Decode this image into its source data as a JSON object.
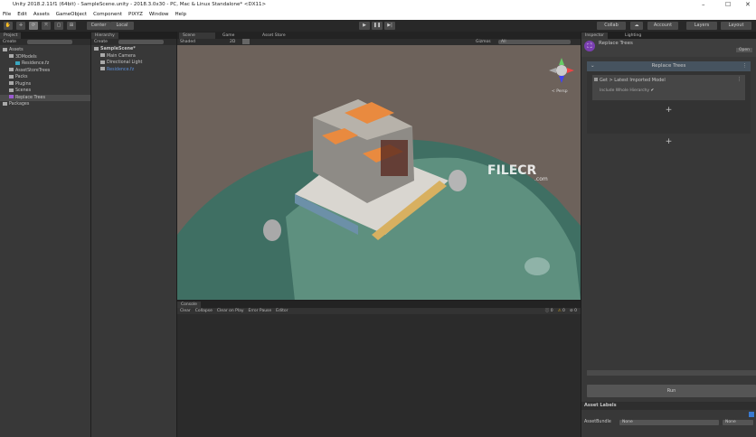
{
  "window": {
    "title": "Unity 2018.2.11f1 (64bit) - SampleScene.unity - 2018.3.0x30 - PC, Mac & Linux Standalone* <DX11>"
  },
  "menu": [
    "File",
    "Edit",
    "Assets",
    "GameObject",
    "Component",
    "PIXYZ",
    "Window",
    "Help"
  ],
  "toolbar": {
    "pivot": "Center",
    "space": "Local",
    "collab": "Collab",
    "account": "Account",
    "layers": "Layers",
    "layout": "Layout"
  },
  "project": {
    "tab": "Project",
    "create": "Create",
    "items": [
      {
        "label": "Assets",
        "depth": 0
      },
      {
        "label": "3DModels",
        "depth": 1
      },
      {
        "label": "Residence.fz",
        "depth": 2
      },
      {
        "label": "AssetStoreTrees",
        "depth": 1
      },
      {
        "label": "Packs",
        "depth": 1
      },
      {
        "label": "Plugins",
        "depth": 1
      },
      {
        "label": "Scenes",
        "depth": 1
      },
      {
        "label": "Replace Trees",
        "depth": 1
      },
      {
        "label": "Packages",
        "depth": 0
      }
    ]
  },
  "hierarchy": {
    "tab": "Hierarchy",
    "create": "Create",
    "items": [
      {
        "label": "SampleScene*",
        "depth": 0
      },
      {
        "label": "Main Camera",
        "depth": 1
      },
      {
        "label": "Directional Light",
        "depth": 1
      },
      {
        "label": "Residence.fz",
        "depth": 1
      }
    ]
  },
  "scene": {
    "tabs": [
      "Scene",
      "Game",
      "Asset Store"
    ],
    "shading": "Shaded",
    "mode2d": "2D",
    "gizmos": "Gizmos",
    "search": "All",
    "persp": "< Persp",
    "watermark": "FILECR",
    "watermark_sub": ".com"
  },
  "console": {
    "tab": "Console",
    "buttons": [
      "Clear",
      "Collapse",
      "Clear on Play",
      "Error Pause",
      "Editor"
    ],
    "counts": {
      "info": "0",
      "warn": "0",
      "error": "0"
    }
  },
  "inspector": {
    "tabs": [
      "Inspector",
      "Lighting"
    ],
    "object_name": "Replace Trees",
    "open": "Open",
    "section": "Replace Trees",
    "step": "Get > Latest Imported Model",
    "option": "Include Whole Hierarchy",
    "add": "+",
    "run": "Run",
    "asset_labels": "Asset Labels",
    "asset_bundle": "AssetBundle",
    "bundle_value": "None",
    "variant_value": "None"
  }
}
